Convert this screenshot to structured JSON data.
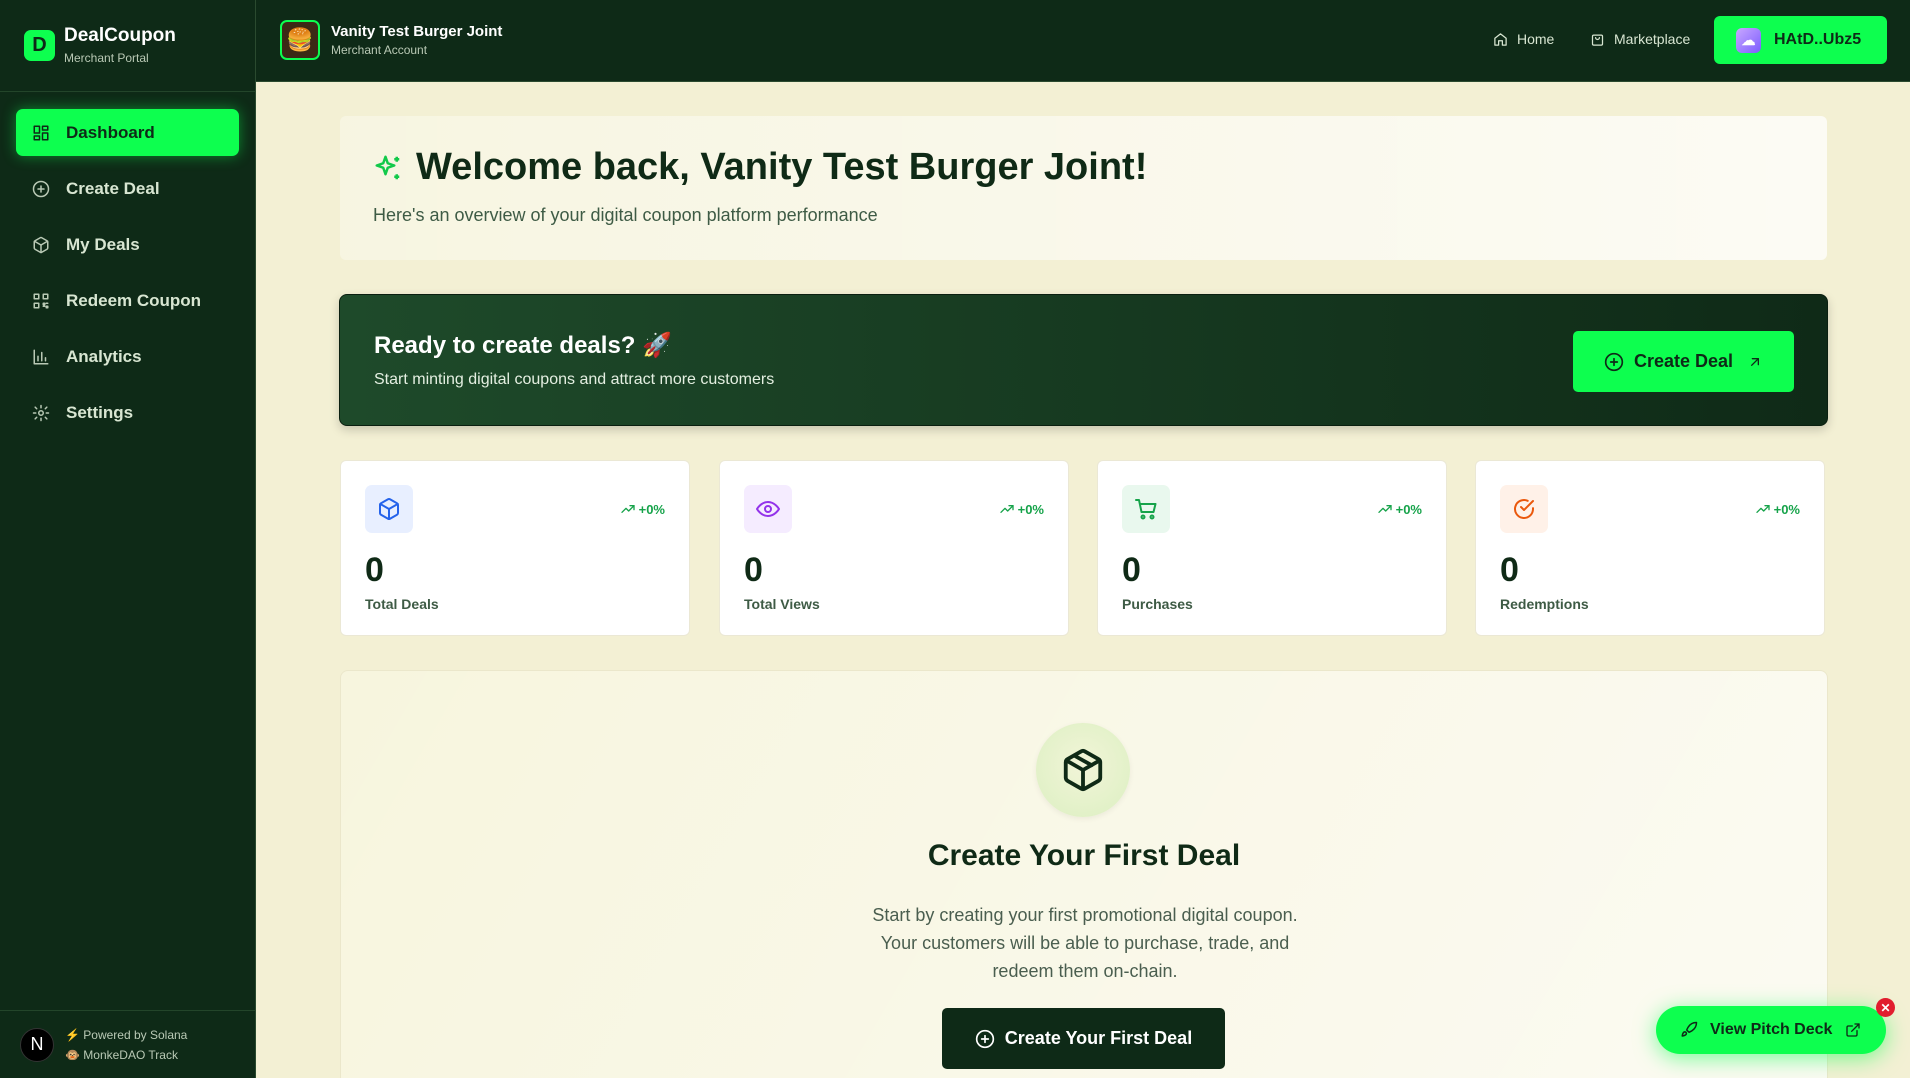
{
  "brand": {
    "logo_letter": "D",
    "name": "DealCoupon",
    "subtitle": "Merchant Portal"
  },
  "sidebar": {
    "items": [
      {
        "label": "Dashboard",
        "icon": "dashboard-icon",
        "active": true
      },
      {
        "label": "Create Deal",
        "icon": "plus-circle-icon"
      },
      {
        "label": "My Deals",
        "icon": "package-icon"
      },
      {
        "label": "Redeem Coupon",
        "icon": "qr-code-icon"
      },
      {
        "label": "Analytics",
        "icon": "bar-chart-icon"
      },
      {
        "label": "Settings",
        "icon": "gear-icon"
      }
    ],
    "footer": {
      "badge_letter": "N",
      "powered": "⚡ Powered by Solana",
      "track": "🐵 MonkeDAO Track"
    }
  },
  "topbar": {
    "merchant_name": "Vanity Test Burger Joint",
    "merchant_sub": "Merchant Account",
    "avatar_emoji": "🍔",
    "home_label": "Home",
    "marketplace_label": "Marketplace",
    "wallet_label": "HAtD..Ubz5"
  },
  "welcome": {
    "title": "Welcome back, Vanity Test Burger Joint!",
    "subtitle": "Here's an overview of your digital coupon platform performance"
  },
  "banner": {
    "title": "Ready to create deals? 🚀",
    "subtitle": "Start minting digital coupons and attract more customers",
    "button_label": "Create Deal"
  },
  "stats": [
    {
      "label": "Total Deals",
      "value": "0",
      "trend": "+0%",
      "icon": "package-icon",
      "color": "#2563eb",
      "bg": "#e8efff"
    },
    {
      "label": "Total Views",
      "value": "0",
      "trend": "+0%",
      "icon": "eye-icon",
      "color": "#9333ea",
      "bg": "#f5ecff"
    },
    {
      "label": "Purchases",
      "value": "0",
      "trend": "+0%",
      "icon": "cart-icon",
      "color": "#16a34a",
      "bg": "#e9f8ee"
    },
    {
      "label": "Redemptions",
      "value": "0",
      "trend": "+0%",
      "icon": "check-circle-icon",
      "color": "#ea580c",
      "bg": "#fff1e8"
    }
  ],
  "empty_state": {
    "title": "Create Your First Deal",
    "line1": "Start by creating your first promotional digital coupon.",
    "line2": "Your customers will be able to purchase, trade, and",
    "line3": "redeem them on-chain.",
    "button_label": "Create Your First Deal"
  },
  "pitch": {
    "label": "View Pitch Deck",
    "close": "✕"
  },
  "colors": {
    "accent": "#0dff4f",
    "dark": "#0e2a17",
    "background": "#f3f0d4"
  }
}
